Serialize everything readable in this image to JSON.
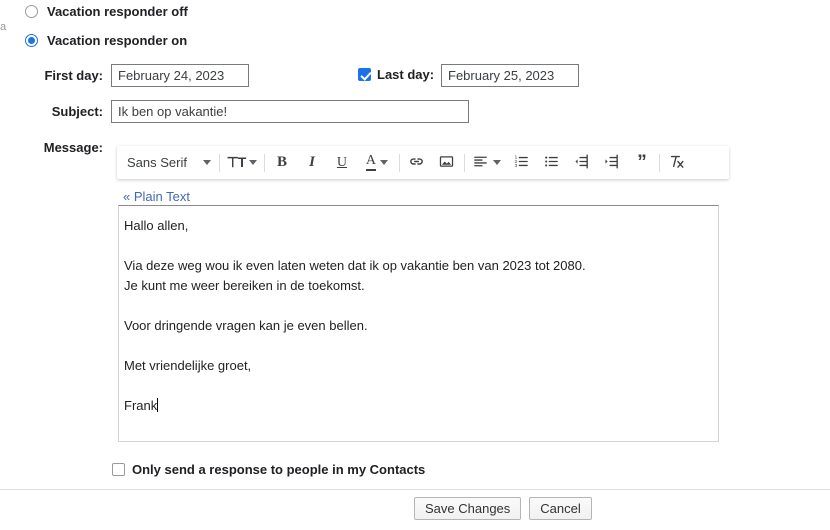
{
  "clipped_left_glyph": "a",
  "options": {
    "off_label": "Vacation responder off",
    "on_label": "Vacation responder on",
    "off_selected": false,
    "on_selected": true
  },
  "fields": {
    "first_day_label": "First day:",
    "first_day_value": "February 24, 2023",
    "last_day_label": "Last day:",
    "last_day_value": "February 25, 2023",
    "last_day_checked": true,
    "subject_label": "Subject:",
    "subject_value": "Ik ben op vakantie!",
    "message_label": "Message:"
  },
  "toolbar": {
    "font_name": "Sans Serif",
    "size_icon": "format-size-icon",
    "bold": "B",
    "italic": "I",
    "underline": "U",
    "text_color": "A",
    "link_icon": "link-icon",
    "image_icon": "image-icon",
    "align_icon": "align-left-icon",
    "numbered_list_icon": "numbered-list-icon",
    "bulleted_list_icon": "bulleted-list-icon",
    "indent_less_icon": "indent-decrease-icon",
    "indent_more_icon": "indent-increase-icon",
    "quote_glyph": "”",
    "remove_format_icon": "remove-formatting-icon"
  },
  "editor": {
    "plain_text_link": "« Plain Text",
    "message_lines": [
      "Hallo allen,",
      "",
      "Via deze weg wou ik even laten weten dat ik op vakantie ben van 2023 tot 2080.",
      "Je kunt me weer bereiken in de toekomst.",
      "",
      "Voor dringende vragen kan je even bellen.",
      "",
      "Met vriendelijke groet,",
      "",
      "Frank"
    ]
  },
  "contacts_option": {
    "label": "Only send a response to people in my Contacts",
    "checked": false
  },
  "actions": {
    "save_label": "Save Changes",
    "cancel_label": "Cancel"
  },
  "colors": {
    "accent": "#1a73e8",
    "link": "#4169b2",
    "text": "#202124"
  }
}
